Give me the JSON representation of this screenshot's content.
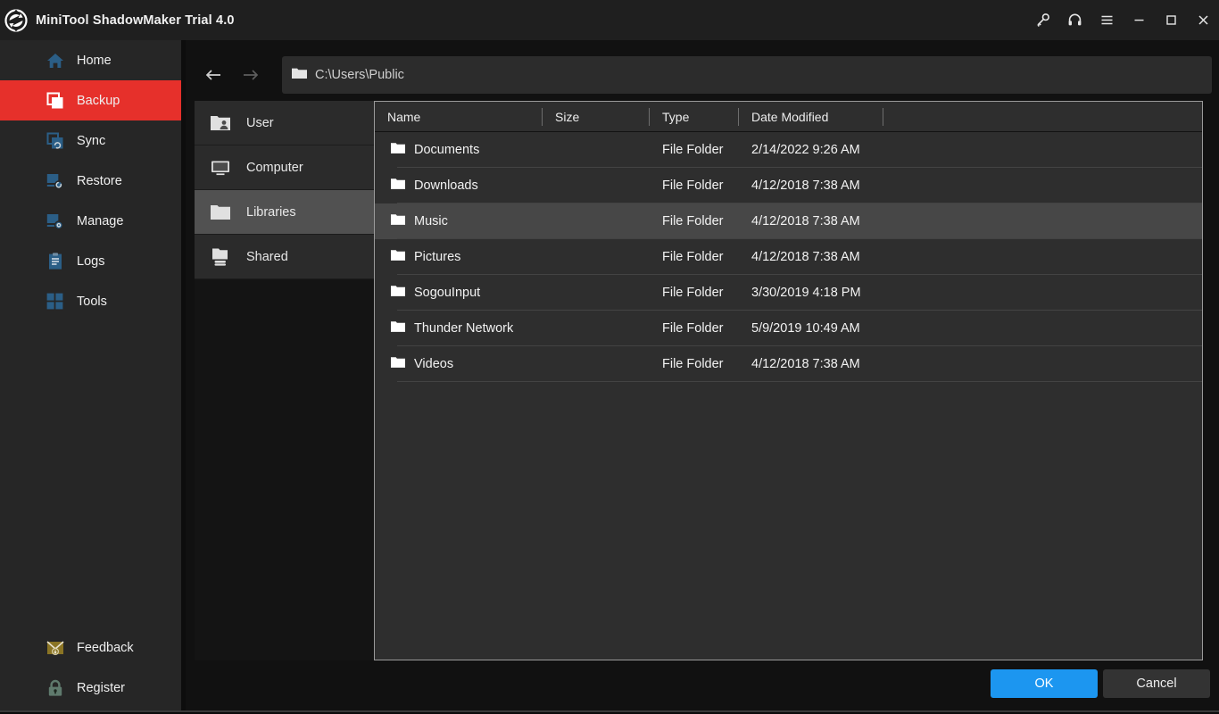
{
  "window": {
    "title": "MiniTool ShadowMaker Trial 4.0",
    "logo_icon": "sync-circle-logo",
    "controls": [
      {
        "name": "key-icon",
        "label": "Key",
        "glyph": "key"
      },
      {
        "name": "support-icon",
        "label": "Support",
        "glyph": "headset"
      },
      {
        "name": "menu-icon",
        "label": "Menu",
        "glyph": "hamburger"
      },
      {
        "name": "minimize-icon",
        "label": "Minimize",
        "glyph": "minimize"
      },
      {
        "name": "maximize-icon",
        "label": "Maximize",
        "glyph": "maximize"
      },
      {
        "name": "close-icon",
        "label": "Close",
        "glyph": "close"
      }
    ]
  },
  "sidebar": {
    "top_items": [
      {
        "label": "Home",
        "icon": "home-icon",
        "active": false
      },
      {
        "label": "Backup",
        "icon": "backup-icon",
        "active": true
      },
      {
        "label": "Sync",
        "icon": "sync-icon",
        "active": false
      },
      {
        "label": "Restore",
        "icon": "restore-icon",
        "active": false
      },
      {
        "label": "Manage",
        "icon": "manage-icon",
        "active": false
      },
      {
        "label": "Logs",
        "icon": "logs-icon",
        "active": false
      },
      {
        "label": "Tools",
        "icon": "tools-icon",
        "active": false
      }
    ],
    "bottom_items": [
      {
        "label": "Feedback",
        "icon": "feedback-envelope-icon"
      },
      {
        "label": "Register",
        "icon": "register-lock-icon"
      }
    ]
  },
  "browser": {
    "back_label": "Back",
    "forward_label": "Forward",
    "back_enabled": true,
    "forward_enabled": false,
    "path_icon": "folder-icon",
    "path": "C:\\Users\\Public",
    "tree": [
      {
        "label": "User",
        "icon": "user-folder-icon",
        "selected": false
      },
      {
        "label": "Computer",
        "icon": "monitor-icon",
        "selected": false
      },
      {
        "label": "Libraries",
        "icon": "folder-icon",
        "selected": true
      },
      {
        "label": "Shared",
        "icon": "shared-folder-icon",
        "selected": false
      }
    ],
    "columns": [
      "Name",
      "Size",
      "Type",
      "Date Modified",
      ""
    ],
    "rows": [
      {
        "name": "Documents",
        "size": "",
        "type": "File Folder",
        "date": "2/14/2022 9:26 AM",
        "icon": "folder-icon",
        "hover": false
      },
      {
        "name": "Downloads",
        "size": "",
        "type": "File Folder",
        "date": "4/12/2018 7:38 AM",
        "icon": "folder-icon",
        "hover": false
      },
      {
        "name": "Music",
        "size": "",
        "type": "File Folder",
        "date": "4/12/2018 7:38 AM",
        "icon": "folder-icon",
        "hover": true
      },
      {
        "name": "Pictures",
        "size": "",
        "type": "File Folder",
        "date": "4/12/2018 7:38 AM",
        "icon": "folder-icon",
        "hover": false
      },
      {
        "name": "SogouInput",
        "size": "",
        "type": "File Folder",
        "date": "3/30/2019 4:18 PM",
        "icon": "folder-icon",
        "hover": false
      },
      {
        "name": "Thunder Network",
        "size": "",
        "type": "File Folder",
        "date": "5/9/2019 10:49 AM",
        "icon": "folder-icon",
        "hover": false
      },
      {
        "name": "Videos",
        "size": "",
        "type": "File Folder",
        "date": "4/12/2018 7:38 AM",
        "icon": "folder-icon",
        "hover": false
      }
    ]
  },
  "footer": {
    "ok_label": "OK",
    "cancel_label": "Cancel"
  },
  "colors": {
    "accent_red": "#e6302b",
    "accent_blue": "#1c96f0",
    "nav_icon_blue": "#2b5e86",
    "window_bg": "#111111",
    "titlebar_bg": "#1f1f1f",
    "sidebar_bg": "#262626",
    "panel_bg": "#2e2e2e",
    "row_hover": "#474747",
    "tree_selected": "#515151",
    "feedback_icon": "#8a7424",
    "register_icon": "#5f7a6d"
  }
}
